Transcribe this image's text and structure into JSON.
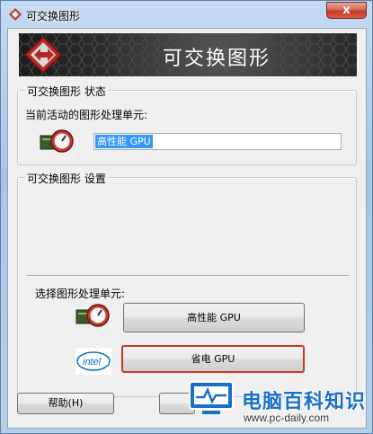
{
  "window": {
    "title": "可交换图形",
    "close_symbol": "x"
  },
  "banner": {
    "title": "可交换图形"
  },
  "status_group": {
    "label": "可交换图形 状态",
    "current_label": "当前活动的图形处理单元:",
    "current_value": "高性能 GPU"
  },
  "settings_group": {
    "label": "可交换图形 设置",
    "select_label": "选择图形处理单元:",
    "high_perf_button": "高性能 GPU",
    "power_save_button": "省电 GPU",
    "intel_logo_text": "intel"
  },
  "footer": {
    "help_button": "帮助(H)"
  },
  "watermark": {
    "name": "电脑百科知识",
    "url": "www.pc-daily.com"
  },
  "colors": {
    "selection": "#3399ff",
    "highlight_border": "#c0392b",
    "watermark_blue": "#1a6fc9"
  }
}
